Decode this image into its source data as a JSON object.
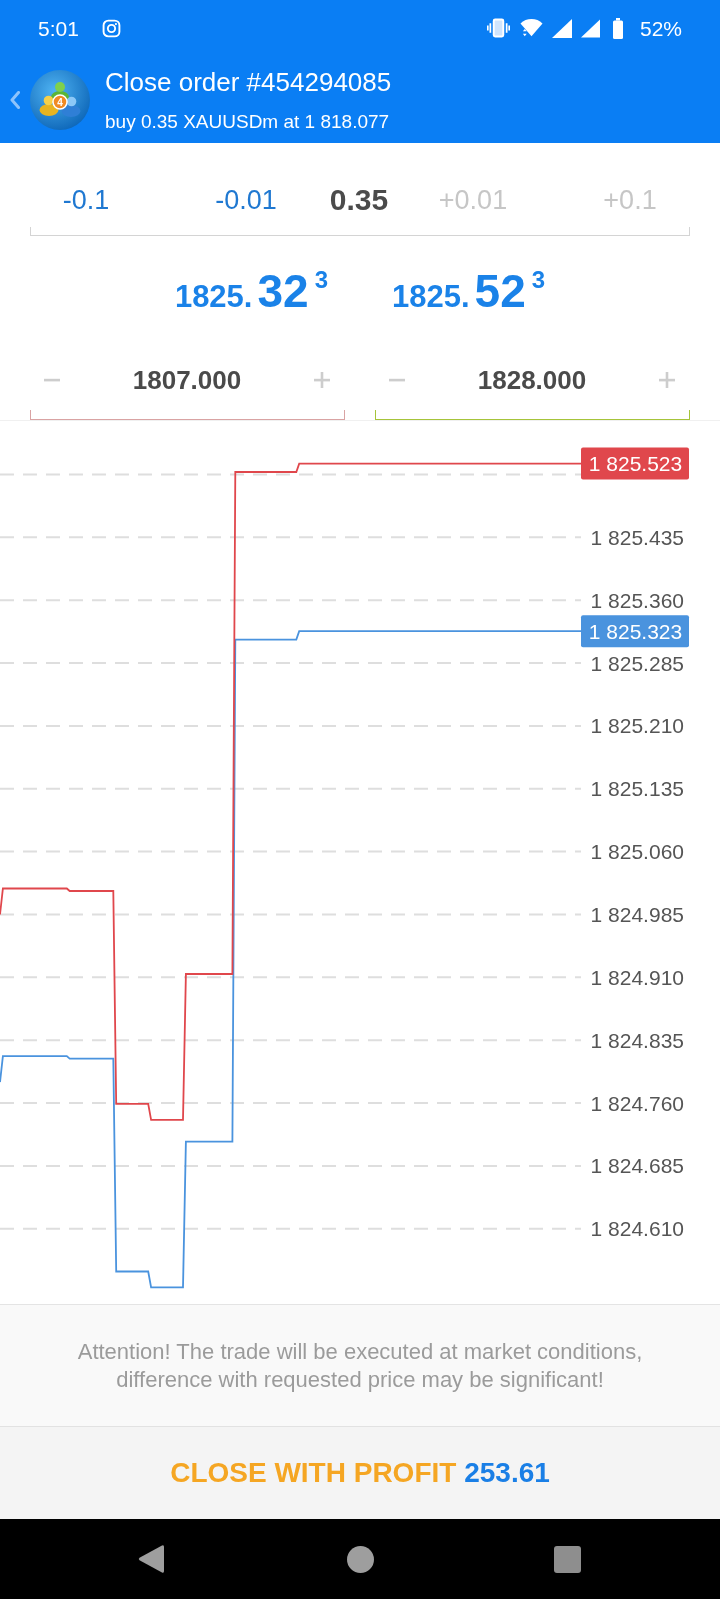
{
  "status_bar": {
    "time": "5:01",
    "battery": "52%"
  },
  "header": {
    "logo_badge": "4",
    "title": "Close order #454294085",
    "subtitle": "buy 0.35 XAUUSDm at 1 818.077"
  },
  "volume": {
    "decrease": [
      {
        "label": "-0.1",
        "disabled": false
      },
      {
        "label": "-0.01",
        "disabled": false
      }
    ],
    "value": "0.35",
    "increase": [
      {
        "label": "+0.01",
        "disabled": true
      },
      {
        "label": "+0.1",
        "disabled": true
      }
    ]
  },
  "quotes": [
    {
      "prefix": "1825.",
      "pips": "32",
      "last": "3"
    },
    {
      "prefix": "1825.",
      "pips": "52",
      "last": "3"
    }
  ],
  "levels": [
    {
      "value": "1807.000",
      "color": "#d9a3a3"
    },
    {
      "value": "1828.000",
      "color": "#a6c43a"
    }
  ],
  "chart": {
    "chart_data": {
      "type": "line",
      "grid": true,
      "categories": [
        null,
        null,
        null,
        null,
        null,
        null,
        null,
        null,
        null,
        null,
        null,
        null,
        null,
        null,
        null,
        null,
        null,
        null,
        null,
        null,
        null,
        null,
        null,
        null,
        null,
        null,
        null,
        null,
        null,
        null,
        null,
        null,
        null,
        null,
        null,
        null,
        null,
        null,
        null,
        null,
        null,
        null,
        null,
        null,
        null,
        null,
        null,
        null,
        null,
        null,
        null,
        null,
        null,
        null,
        null,
        null,
        null,
        null,
        null,
        null,
        null,
        null,
        null,
        null,
        null,
        null,
        null,
        null,
        null,
        null,
        null,
        null,
        null,
        null,
        null,
        null,
        null,
        null,
        null,
        null,
        null,
        null,
        null,
        null,
        null,
        null,
        null,
        null,
        null,
        null,
        null,
        null,
        null,
        null,
        null,
        null,
        null,
        null,
        null,
        null,
        null,
        null,
        null,
        null,
        null,
        null,
        null,
        null,
        null,
        null,
        null,
        null,
        null,
        null,
        null,
        null,
        null,
        null,
        null,
        null,
        null,
        null,
        null,
        null,
        null,
        null,
        null,
        null,
        null,
        null,
        null,
        null,
        null,
        null,
        null,
        null,
        null,
        null,
        null,
        null,
        null,
        null,
        null,
        null,
        null,
        null,
        null,
        null,
        null,
        null,
        null,
        null,
        null,
        null,
        null,
        null,
        null,
        null,
        null,
        null,
        null,
        null,
        null,
        null,
        null,
        null,
        null,
        null,
        null,
        null,
        null,
        null,
        null,
        null,
        null,
        null,
        null,
        null,
        null,
        null,
        null,
        null,
        null,
        null,
        null,
        null,
        null,
        null,
        null,
        null,
        null,
        null,
        null,
        null,
        null,
        null,
        null,
        null,
        null,
        null,
        null
      ],
      "series": [
        {
          "color": "#e0474c",
          "values": [
            1824.985,
            1825.016,
            1825.016,
            1825.016,
            1825.016,
            1825.016,
            1825.016,
            1825.016,
            1825.016,
            1825.016,
            1825.016,
            1825.016,
            1825.016,
            1825.016,
            1825.016,
            1825.016,
            1825.016,
            1825.016,
            1825.016,
            1825.016,
            1825.016,
            1825.016,
            1825.016,
            1825.016,
            1825.013,
            1825.013,
            1825.013,
            1825.013,
            1825.013,
            1825.013,
            1825.013,
            1825.013,
            1825.013,
            1825.013,
            1825.013,
            1825.013,
            1825.013,
            1825.013,
            1825.013,
            1825.013,
            1824.759,
            1824.759,
            1824.759,
            1824.759,
            1824.759,
            1824.759,
            1824.759,
            1824.759,
            1824.759,
            1824.759,
            1824.759,
            1824.759,
            1824.74,
            1824.74,
            1824.74,
            1824.74,
            1824.74,
            1824.74,
            1824.74,
            1824.74,
            1824.74,
            1824.74,
            1824.74,
            1824.74,
            1824.914,
            1824.914,
            1824.914,
            1824.914,
            1824.914,
            1824.914,
            1824.914,
            1824.914,
            1824.914,
            1824.914,
            1824.914,
            1824.914,
            1824.914,
            1824.914,
            1824.914,
            1824.914,
            1824.914,
            1825.513,
            1825.513,
            1825.513,
            1825.513,
            1825.513,
            1825.513,
            1825.513,
            1825.513,
            1825.513,
            1825.513,
            1825.513,
            1825.513,
            1825.513,
            1825.513,
            1825.513,
            1825.513,
            1825.513,
            1825.513,
            1825.513,
            1825.513,
            1825.513,
            1825.513,
            1825.523,
            1825.523,
            1825.523,
            1825.523,
            1825.523,
            1825.523,
            1825.523,
            1825.523,
            1825.523,
            1825.523,
            1825.523,
            1825.523,
            1825.523,
            1825.523,
            1825.523,
            1825.523,
            1825.523,
            1825.523,
            1825.523,
            1825.523,
            1825.523,
            1825.523,
            1825.523,
            1825.523,
            1825.523,
            1825.523,
            1825.523,
            1825.523,
            1825.523,
            1825.523,
            1825.523,
            1825.523,
            1825.523,
            1825.523,
            1825.523,
            1825.523,
            1825.523,
            1825.523,
            1825.523,
            1825.523,
            1825.523,
            1825.523,
            1825.523,
            1825.523,
            1825.523,
            1825.523,
            1825.523,
            1825.523,
            1825.523,
            1825.523,
            1825.523,
            1825.523,
            1825.523,
            1825.523,
            1825.523,
            1825.523,
            1825.523,
            1825.523,
            1825.523,
            1825.523,
            1825.523,
            1825.523,
            1825.523,
            1825.523,
            1825.523,
            1825.523,
            1825.523,
            1825.523,
            1825.523,
            1825.523,
            1825.523,
            1825.523,
            1825.523,
            1825.523,
            1825.523,
            1825.523,
            1825.523,
            1825.523,
            1825.523,
            1825.523,
            1825.523,
            1825.523,
            1825.523,
            1825.523,
            1825.523,
            1825.523,
            1825.523,
            1825.523,
            1825.523,
            1825.523,
            1825.523,
            1825.523,
            1825.523,
            1825.523,
            1825.523,
            1825.523,
            1825.523,
            1825.523
          ]
        },
        {
          "color": "#4a93de",
          "values": [
            1824.785,
            1824.816,
            1824.816,
            1824.816,
            1824.816,
            1824.816,
            1824.816,
            1824.816,
            1824.816,
            1824.816,
            1824.816,
            1824.816,
            1824.816,
            1824.816,
            1824.816,
            1824.816,
            1824.816,
            1824.816,
            1824.816,
            1824.816,
            1824.816,
            1824.816,
            1824.816,
            1824.816,
            1824.813,
            1824.813,
            1824.813,
            1824.813,
            1824.813,
            1824.813,
            1824.813,
            1824.813,
            1824.813,
            1824.813,
            1824.813,
            1824.813,
            1824.813,
            1824.813,
            1824.813,
            1824.813,
            1824.559,
            1824.559,
            1824.559,
            1824.559,
            1824.559,
            1824.559,
            1824.559,
            1824.559,
            1824.559,
            1824.559,
            1824.559,
            1824.559,
            1824.54,
            1824.54,
            1824.54,
            1824.54,
            1824.54,
            1824.54,
            1824.54,
            1824.54,
            1824.54,
            1824.54,
            1824.54,
            1824.54,
            1824.714,
            1824.714,
            1824.714,
            1824.714,
            1824.714,
            1824.714,
            1824.714,
            1824.714,
            1824.714,
            1824.714,
            1824.714,
            1824.714,
            1824.714,
            1824.714,
            1824.714,
            1824.714,
            1824.714,
            1825.313,
            1825.313,
            1825.313,
            1825.313,
            1825.313,
            1825.313,
            1825.313,
            1825.313,
            1825.313,
            1825.313,
            1825.313,
            1825.313,
            1825.313,
            1825.313,
            1825.313,
            1825.313,
            1825.313,
            1825.313,
            1825.313,
            1825.313,
            1825.313,
            1825.313,
            1825.323,
            1825.323,
            1825.323,
            1825.323,
            1825.323,
            1825.323,
            1825.323,
            1825.323,
            1825.323,
            1825.323,
            1825.323,
            1825.323,
            1825.323,
            1825.323,
            1825.323,
            1825.323,
            1825.323,
            1825.323,
            1825.323,
            1825.323,
            1825.323,
            1825.323,
            1825.323,
            1825.323,
            1825.323,
            1825.323,
            1825.323,
            1825.323,
            1825.323,
            1825.323,
            1825.323,
            1825.323,
            1825.323,
            1825.323,
            1825.323,
            1825.323,
            1825.323,
            1825.323,
            1825.323,
            1825.323,
            1825.323,
            1825.323,
            1825.323,
            1825.323,
            1825.323,
            1825.323,
            1825.323,
            1825.323,
            1825.323,
            1825.323,
            1825.323,
            1825.323,
            1825.323,
            1825.323,
            1825.323,
            1825.323,
            1825.323,
            1825.323,
            1825.323,
            1825.323,
            1825.323,
            1825.323,
            1825.323,
            1825.323,
            1825.323,
            1825.323,
            1825.323,
            1825.323,
            1825.323,
            1825.323,
            1825.323,
            1825.323,
            1825.323,
            1825.323,
            1825.323,
            1825.323,
            1825.323,
            1825.323,
            1825.323,
            1825.323,
            1825.323,
            1825.323,
            1825.323,
            1825.323,
            1825.323,
            1825.323,
            1825.323,
            1825.323,
            1825.323,
            1825.323,
            1825.323,
            1825.323,
            1825.323,
            1825.323,
            1825.323,
            1825.323,
            1825.323,
            1825.323
          ]
        }
      ],
      "ylim": [
        1824.519,
        1825.575
      ],
      "yticks": [
        {
          "value": 1825.435,
          "label": "1 825.435"
        },
        {
          "value": 1825.36,
          "label": "1 825.360"
        },
        {
          "value": 1825.285,
          "label": "1 825.285"
        },
        {
          "value": 1825.21,
          "label": "1 825.210"
        },
        {
          "value": 1825.135,
          "label": "1 825.135"
        },
        {
          "value": 1825.06,
          "label": "1 825.060"
        },
        {
          "value": 1824.985,
          "label": "1 824.985"
        },
        {
          "value": 1824.91,
          "label": "1 824.910"
        },
        {
          "value": 1824.835,
          "label": "1 824.835"
        },
        {
          "value": 1824.76,
          "label": "1 824.760"
        },
        {
          "value": 1824.685,
          "label": "1 824.685"
        },
        {
          "value": 1824.61,
          "label": "1 824.610"
        }
      ],
      "annotations": [
        "1 825.523",
        "1 825.323"
      ]
    }
  },
  "notice": "Attention! The trade will be executed at market conditions, difference with requested price may be significant!",
  "close_button": {
    "label": "CLOSE WITH PROFIT",
    "profit": "253.61"
  }
}
